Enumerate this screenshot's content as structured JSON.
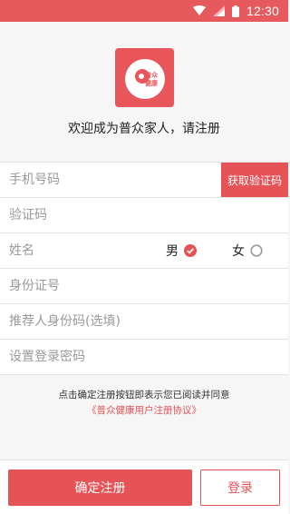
{
  "status_bar": {
    "time": "12:30",
    "icons": [
      "wifi-icon",
      "signal-icon",
      "battery-icon"
    ]
  },
  "logo": {
    "text_line1": "普众",
    "text_line2": "健康"
  },
  "welcome": "欢迎成为普众家人，请注册",
  "form": {
    "phone_placeholder": "手机号码",
    "get_code_label": "获取验证码",
    "code_placeholder": "验证码",
    "name_placeholder": "姓名",
    "gender": {
      "male_label": "男",
      "female_label": "女",
      "selected": "男"
    },
    "id_placeholder": "身份证号",
    "referrer_placeholder": "推荐人身份码(选填)",
    "password_placeholder": "设置登录密码"
  },
  "agreement": {
    "text": "点击确定注册按钮即表示您已阅读并同意",
    "link": "《普众健康用户注册协议》"
  },
  "buttons": {
    "register": "确定注册",
    "login": "登录"
  },
  "colors": {
    "accent": "#e65357",
    "status_bar": "#e65a5d",
    "background": "#f6f6f6"
  }
}
